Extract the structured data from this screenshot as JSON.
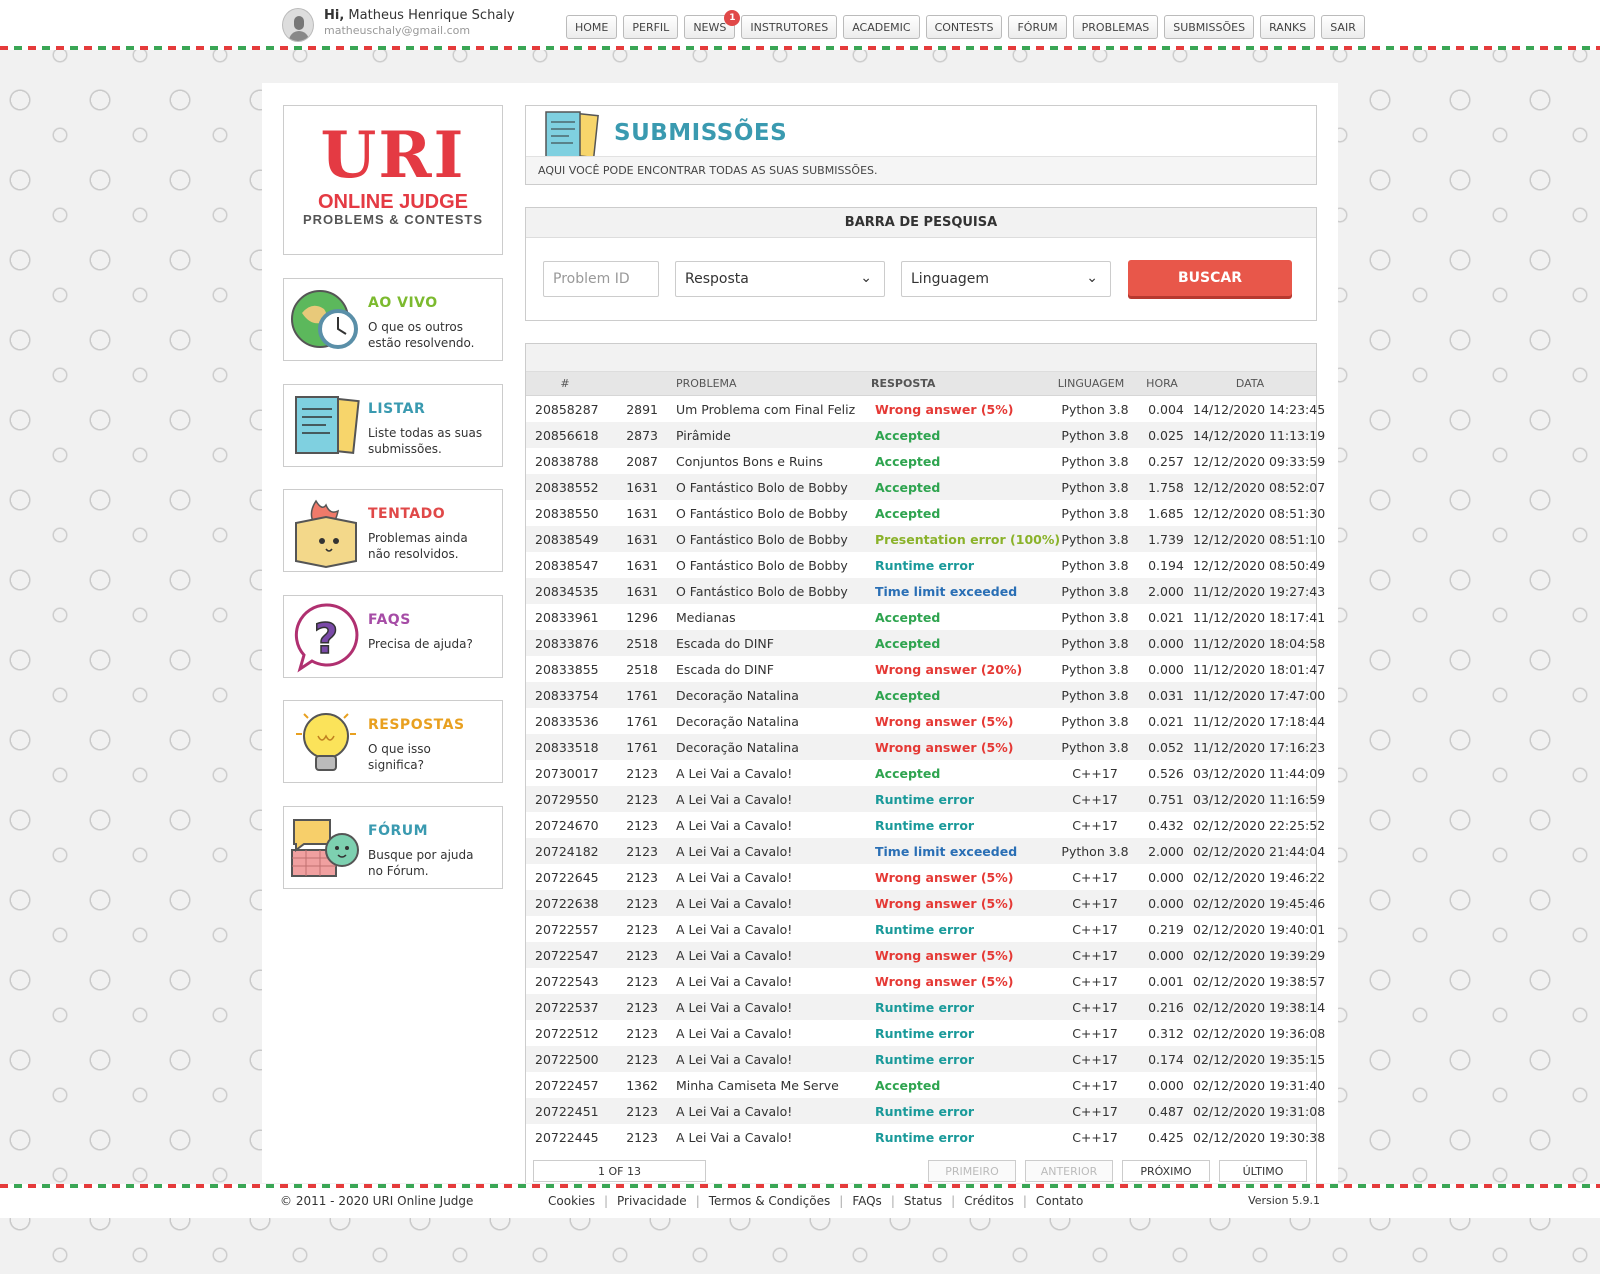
{
  "header": {
    "greeting": "Hi,",
    "user_name": "Matheus Henrique Schaly",
    "email": "matheuschaly@gmail.com",
    "nav": [
      {
        "label": "HOME"
      },
      {
        "label": "PERFIL"
      },
      {
        "label": "NEWS",
        "badge": "1"
      },
      {
        "label": "INSTRUTORES"
      },
      {
        "label": "ACADEMIC"
      },
      {
        "label": "CONTESTS"
      },
      {
        "label": "FÓRUM"
      },
      {
        "label": "PROBLEMAS"
      },
      {
        "label": "SUBMISSÕES"
      },
      {
        "label": "RANKS"
      },
      {
        "label": "SAIR"
      }
    ]
  },
  "logo": {
    "uri": "URI",
    "online_judge": "ONLINE JUDGE",
    "tagline": "PROBLEMS & CONTESTS"
  },
  "sidebar": [
    {
      "title": "AO VIVO",
      "desc": "O que os outros estão resolvendo.",
      "color": "#7cba2f",
      "icon": "globe-clock-icon"
    },
    {
      "title": "LISTAR",
      "desc": "Liste todas as suas submissões.",
      "color": "#3a9ab0",
      "icon": "documents-icon"
    },
    {
      "title": "TENTADO",
      "desc": "Problemas ainda não resolvidos.",
      "color": "#e04848",
      "icon": "burning-box-icon"
    },
    {
      "title": "FAQS",
      "desc": "Precisa de ajuda?",
      "color": "#a64ca6",
      "icon": "question-bubble-icon"
    },
    {
      "title": "RESPOSTAS",
      "desc": "O que isso significa?",
      "color": "#e8a020",
      "icon": "lightbulb-icon"
    },
    {
      "title": "FÓRUM",
      "desc": "Busque por ajuda no Fórum.",
      "color": "#3a9ab0",
      "icon": "chat-bubbles-icon"
    }
  ],
  "page": {
    "title": "SUBMISSÕES",
    "subtitle": "AQUI VOCÊ PODE ENCONTRAR TODAS AS SUAS SUBMISSÕES."
  },
  "search": {
    "title": "BARRA DE PESQUISA",
    "problem_placeholder": "Problem ID",
    "answer_value": "Resposta",
    "language_value": "Linguagem",
    "button": "BUSCAR"
  },
  "table": {
    "columns": [
      "#",
      "PROBLEMA",
      "RESPOSTA",
      "LINGUAGEM",
      "HORA",
      "DATA"
    ],
    "rows": [
      {
        "id": "20858287",
        "pid": "2891",
        "problem": "Um Problema com Final Feliz",
        "result": "Wrong answer (5%)",
        "lang": "Python 3.8",
        "time": "0.004",
        "date": "14/12/2020 14:23:45"
      },
      {
        "id": "20856618",
        "pid": "2873",
        "problem": "Pirâmide",
        "result": "Accepted",
        "lang": "Python 3.8",
        "time": "0.025",
        "date": "14/12/2020 11:13:19"
      },
      {
        "id": "20838788",
        "pid": "2087",
        "problem": "Conjuntos Bons e Ruins",
        "result": "Accepted",
        "lang": "Python 3.8",
        "time": "0.257",
        "date": "12/12/2020 09:33:59"
      },
      {
        "id": "20838552",
        "pid": "1631",
        "problem": "O Fantástico Bolo de Bobby",
        "result": "Accepted",
        "lang": "Python 3.8",
        "time": "1.758",
        "date": "12/12/2020 08:52:07"
      },
      {
        "id": "20838550",
        "pid": "1631",
        "problem": "O Fantástico Bolo de Bobby",
        "result": "Accepted",
        "lang": "Python 3.8",
        "time": "1.685",
        "date": "12/12/2020 08:51:30"
      },
      {
        "id": "20838549",
        "pid": "1631",
        "problem": "O Fantástico Bolo de Bobby",
        "result": "Presentation error (100%)",
        "lang": "Python 3.8",
        "time": "1.739",
        "date": "12/12/2020 08:51:10"
      },
      {
        "id": "20838547",
        "pid": "1631",
        "problem": "O Fantástico Bolo de Bobby",
        "result": "Runtime error",
        "lang": "Python 3.8",
        "time": "0.194",
        "date": "12/12/2020 08:50:49"
      },
      {
        "id": "20834535",
        "pid": "1631",
        "problem": "O Fantástico Bolo de Bobby",
        "result": "Time limit exceeded",
        "lang": "Python 3.8",
        "time": "2.000",
        "date": "11/12/2020 19:27:43"
      },
      {
        "id": "20833961",
        "pid": "1296",
        "problem": "Medianas",
        "result": "Accepted",
        "lang": "Python 3.8",
        "time": "0.021",
        "date": "11/12/2020 18:17:41"
      },
      {
        "id": "20833876",
        "pid": "2518",
        "problem": "Escada do DINF",
        "result": "Accepted",
        "lang": "Python 3.8",
        "time": "0.000",
        "date": "11/12/2020 18:04:58"
      },
      {
        "id": "20833855",
        "pid": "2518",
        "problem": "Escada do DINF",
        "result": "Wrong answer (20%)",
        "lang": "Python 3.8",
        "time": "0.000",
        "date": "11/12/2020 18:01:47"
      },
      {
        "id": "20833754",
        "pid": "1761",
        "problem": "Decoração Natalina",
        "result": "Accepted",
        "lang": "Python 3.8",
        "time": "0.031",
        "date": "11/12/2020 17:47:00"
      },
      {
        "id": "20833536",
        "pid": "1761",
        "problem": "Decoração Natalina",
        "result": "Wrong answer (5%)",
        "lang": "Python 3.8",
        "time": "0.021",
        "date": "11/12/2020 17:18:44"
      },
      {
        "id": "20833518",
        "pid": "1761",
        "problem": "Decoração Natalina",
        "result": "Wrong answer (5%)",
        "lang": "Python 3.8",
        "time": "0.052",
        "date": "11/12/2020 17:16:23"
      },
      {
        "id": "20730017",
        "pid": "2123",
        "problem": "A Lei Vai a Cavalo!",
        "result": "Accepted",
        "lang": "C++17",
        "time": "0.526",
        "date": "03/12/2020 11:44:09"
      },
      {
        "id": "20729550",
        "pid": "2123",
        "problem": "A Lei Vai a Cavalo!",
        "result": "Runtime error",
        "lang": "C++17",
        "time": "0.751",
        "date": "03/12/2020 11:16:59"
      },
      {
        "id": "20724670",
        "pid": "2123",
        "problem": "A Lei Vai a Cavalo!",
        "result": "Runtime error",
        "lang": "C++17",
        "time": "0.432",
        "date": "02/12/2020 22:25:52"
      },
      {
        "id": "20724182",
        "pid": "2123",
        "problem": "A Lei Vai a Cavalo!",
        "result": "Time limit exceeded",
        "lang": "Python 3.8",
        "time": "2.000",
        "date": "02/12/2020 21:44:04"
      },
      {
        "id": "20722645",
        "pid": "2123",
        "problem": "A Lei Vai a Cavalo!",
        "result": "Wrong answer (5%)",
        "lang": "C++17",
        "time": "0.000",
        "date": "02/12/2020 19:46:22"
      },
      {
        "id": "20722638",
        "pid": "2123",
        "problem": "A Lei Vai a Cavalo!",
        "result": "Wrong answer (5%)",
        "lang": "C++17",
        "time": "0.000",
        "date": "02/12/2020 19:45:46"
      },
      {
        "id": "20722557",
        "pid": "2123",
        "problem": "A Lei Vai a Cavalo!",
        "result": "Runtime error",
        "lang": "C++17",
        "time": "0.219",
        "date": "02/12/2020 19:40:01"
      },
      {
        "id": "20722547",
        "pid": "2123",
        "problem": "A Lei Vai a Cavalo!",
        "result": "Wrong answer (5%)",
        "lang": "C++17",
        "time": "0.000",
        "date": "02/12/2020 19:39:29"
      },
      {
        "id": "20722543",
        "pid": "2123",
        "problem": "A Lei Vai a Cavalo!",
        "result": "Wrong answer (5%)",
        "lang": "C++17",
        "time": "0.001",
        "date": "02/12/2020 19:38:57"
      },
      {
        "id": "20722537",
        "pid": "2123",
        "problem": "A Lei Vai a Cavalo!",
        "result": "Runtime error",
        "lang": "C++17",
        "time": "0.216",
        "date": "02/12/2020 19:38:14"
      },
      {
        "id": "20722512",
        "pid": "2123",
        "problem": "A Lei Vai a Cavalo!",
        "result": "Runtime error",
        "lang": "C++17",
        "time": "0.312",
        "date": "02/12/2020 19:36:08"
      },
      {
        "id": "20722500",
        "pid": "2123",
        "problem": "A Lei Vai a Cavalo!",
        "result": "Runtime error",
        "lang": "C++17",
        "time": "0.174",
        "date": "02/12/2020 19:35:15"
      },
      {
        "id": "20722457",
        "pid": "1362",
        "problem": "Minha Camiseta Me Serve",
        "result": "Accepted",
        "lang": "C++17",
        "time": "0.000",
        "date": "02/12/2020 19:31:40"
      },
      {
        "id": "20722451",
        "pid": "2123",
        "problem": "A Lei Vai a Cavalo!",
        "result": "Runtime error",
        "lang": "C++17",
        "time": "0.487",
        "date": "02/12/2020 19:31:08"
      },
      {
        "id": "20722445",
        "pid": "2123",
        "problem": "A Lei Vai a Cavalo!",
        "result": "Runtime error",
        "lang": "C++17",
        "time": "0.425",
        "date": "02/12/2020 19:30:38"
      }
    ]
  },
  "result_colors": {
    "Accepted": "#2ea44f",
    "Wrong answer": "#e53935",
    "Runtime error": "#1a9a9a",
    "Time limit exceeded": "#2a6fb5",
    "Presentation error": "#8ab22a"
  },
  "pager": {
    "info": "1 OF 13",
    "first": "PRIMEIRO",
    "prev": "ANTERIOR",
    "next": "PRÓXIMO",
    "last": "ÚLTIMO"
  },
  "footer": {
    "copyright": "© 2011 - 2020 URI Online Judge",
    "links": [
      "Cookies",
      "Privacidade",
      "Termos & Condições",
      "FAQs",
      "Status",
      "Créditos",
      "Contato"
    ],
    "version": "Version 5.9.1"
  }
}
